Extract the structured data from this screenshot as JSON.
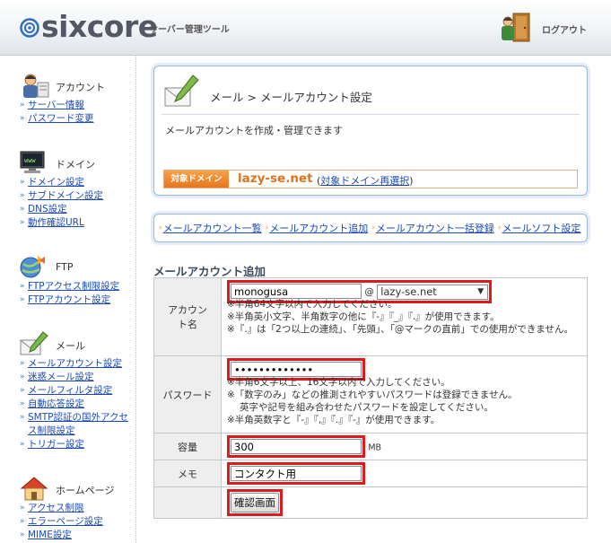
{
  "header": {
    "logo_text": "sixcore",
    "logo_sub": "サーバー管理ツール",
    "logout_label": "ログアウト"
  },
  "sidebar": {
    "groups": [
      {
        "title": "アカウント",
        "icon": "account-icon",
        "links": [
          "サーバー情報",
          "パスワード変更"
        ]
      },
      {
        "title": "ドメイン",
        "icon": "domain-icon",
        "links": [
          "ドメイン設定",
          "サブドメイン設定",
          "DNS設定",
          "動作確認URL"
        ]
      },
      {
        "title": "FTP",
        "icon": "ftp-icon",
        "links": [
          "FTPアクセス制限設定",
          "FTPアカウント設定"
        ]
      },
      {
        "title": "メール",
        "icon": "mail-icon",
        "links": [
          "メールアカウント設定",
          "迷惑メール設定",
          "メールフィルタ設定",
          "自動応答設定",
          "SMTP認証の国外アクセス制限設定",
          "トリガー設定"
        ]
      },
      {
        "title": "ホームページ",
        "icon": "homepage-icon",
        "links": [
          "アクセス制限",
          "エラーページ設定",
          "MIME設定"
        ]
      }
    ]
  },
  "page": {
    "breadcrumb": "メール > メールアカウント設定",
    "description": "メールアカウントを作成・管理できます",
    "domain_tag": "対象ドメイン",
    "domain_name": "lazy-se.net",
    "domain_link_open": "(",
    "domain_link": "対象ドメイン再選択",
    "domain_link_close": ")"
  },
  "nav": [
    "メールアカウント一覧",
    "メールアカウント追加",
    "メールアカウント一括登録",
    "メールソフト設定"
  ],
  "form": {
    "title": "メールアカウント追加",
    "account": {
      "label": "アカウント名",
      "value": "monogusa",
      "at": "@",
      "domain_selected": "lazy-se.net",
      "notes": [
        "※半角64文字以内で入力してください。",
        "※半角英小文字、半角数字の他に『-』『_』『.』が使用できます。",
        "※『.』は「2つ以上の連続」、「先頭」、「@マークの直前」での使用ができません。"
      ]
    },
    "password": {
      "label": "パスワード",
      "value": "•••••••••••••",
      "notes": [
        "※半角6文字以上、16文字以内で入力してください。",
        "※「数字のみ」などの推測されやすいパスワードは登録できません。",
        "英字や記号を組み合わせたパスワードを設定してください。",
        "※半角英数字と『-』『,』『.』『-』が使用できます。"
      ]
    },
    "capacity": {
      "label": "容量",
      "value": "300",
      "unit": "MB"
    },
    "memo": {
      "label": "メモ",
      "value": "コンタクト用"
    },
    "confirm_label": "確認画面"
  },
  "colors": {
    "highlight": "#e01a1a",
    "link": "#1a49b8",
    "domain_orange": "#e0721e"
  }
}
